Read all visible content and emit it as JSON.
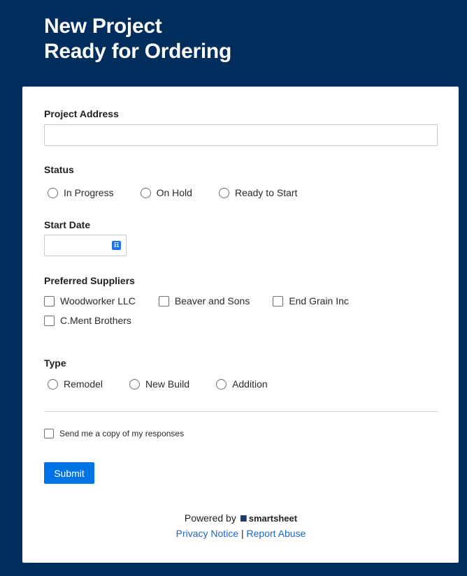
{
  "header": {
    "title_line1": "New Project",
    "title_line2": "Ready for Ordering"
  },
  "form": {
    "project_address": {
      "label": "Project Address",
      "value": ""
    },
    "status": {
      "label": "Status",
      "options": [
        "In Progress",
        "On Hold",
        "Ready to Start"
      ]
    },
    "start_date": {
      "label": "Start Date",
      "value": "",
      "icon_text": "31"
    },
    "preferred_suppliers": {
      "label": "Preferred Suppliers",
      "options": [
        "Woodworker LLC",
        "Beaver and Sons",
        "End Grain Inc",
        "C.Ment Brothers"
      ]
    },
    "type": {
      "label": "Type",
      "options": [
        "Remodel",
        "New Build",
        "Addition"
      ]
    },
    "send_copy_label": "Send me a copy of my responses",
    "submit_label": "Submit"
  },
  "footer": {
    "powered_by": "Powered by",
    "brand": "smartsheet",
    "privacy": "Privacy Notice",
    "separator": "|",
    "report": "Report Abuse"
  },
  "colors": {
    "background": "#002d5c",
    "accent": "#0073e6",
    "link": "#1a66c9"
  }
}
